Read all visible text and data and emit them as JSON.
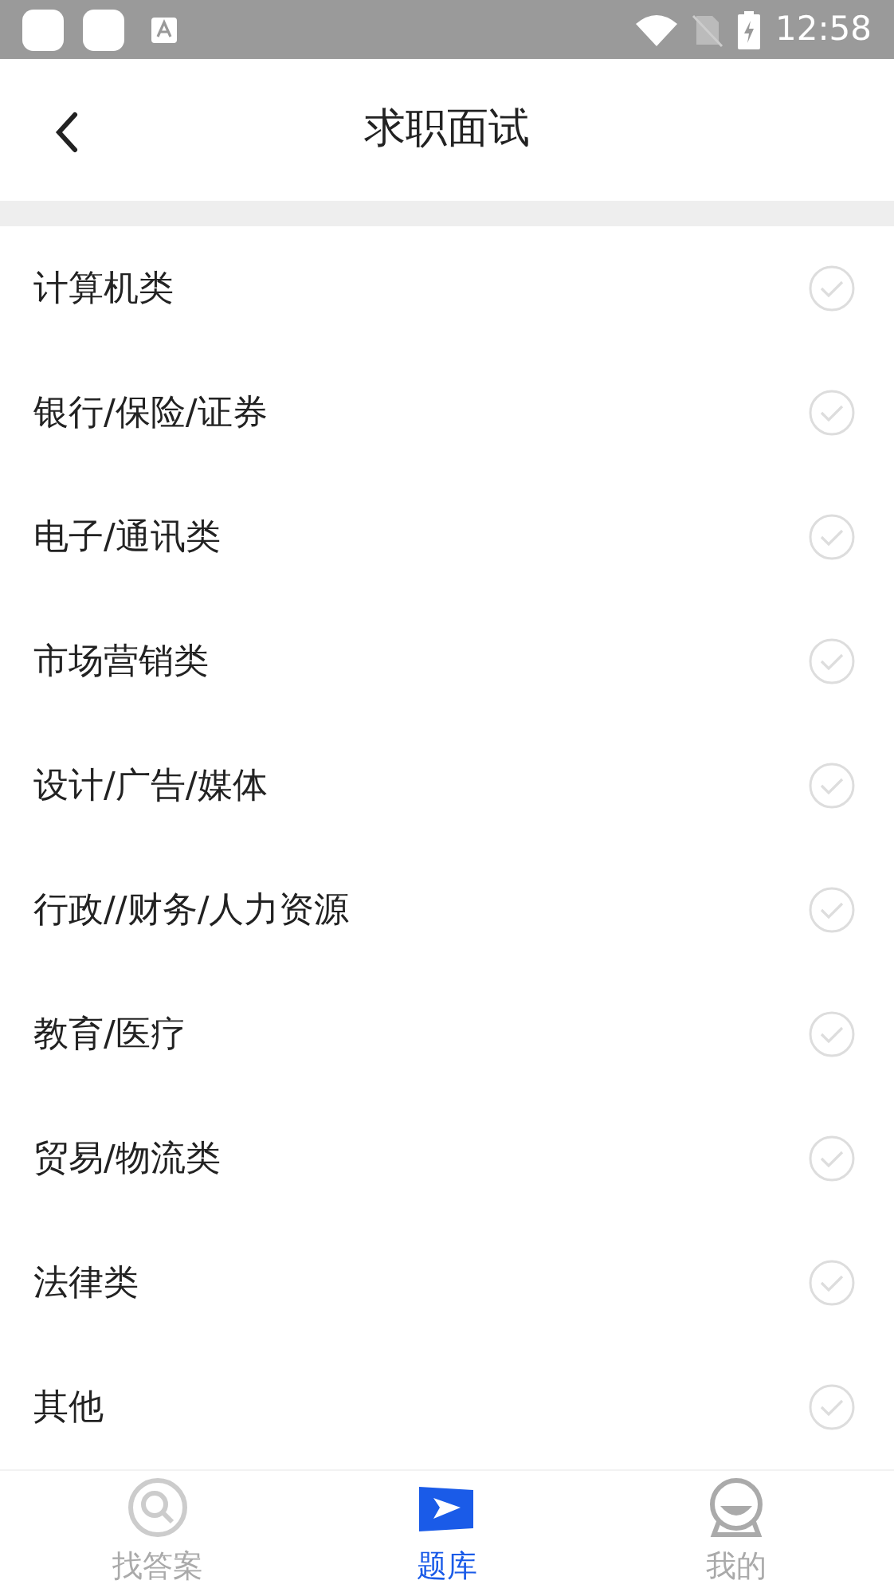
{
  "status_bar": {
    "time": "12:58"
  },
  "header": {
    "title": "求职面试"
  },
  "categories": [
    {
      "label": "计算机类",
      "checked": false
    },
    {
      "label": "银行/保险/证券",
      "checked": false
    },
    {
      "label": "电子/通讯类",
      "checked": false
    },
    {
      "label": "市场营销类",
      "checked": false
    },
    {
      "label": "设计/广告/媒体",
      "checked": false
    },
    {
      "label": "行政//财务/人力资源",
      "checked": false
    },
    {
      "label": "教育/医疗",
      "checked": false
    },
    {
      "label": "贸易/物流类",
      "checked": false
    },
    {
      "label": "法律类",
      "checked": false
    },
    {
      "label": "其他",
      "checked": false
    }
  ],
  "tabs": [
    {
      "label": "找答案",
      "kind": "search",
      "selected": false
    },
    {
      "label": "题库",
      "kind": "bank",
      "selected": true
    },
    {
      "label": "我的",
      "kind": "profile",
      "selected": false
    }
  ]
}
